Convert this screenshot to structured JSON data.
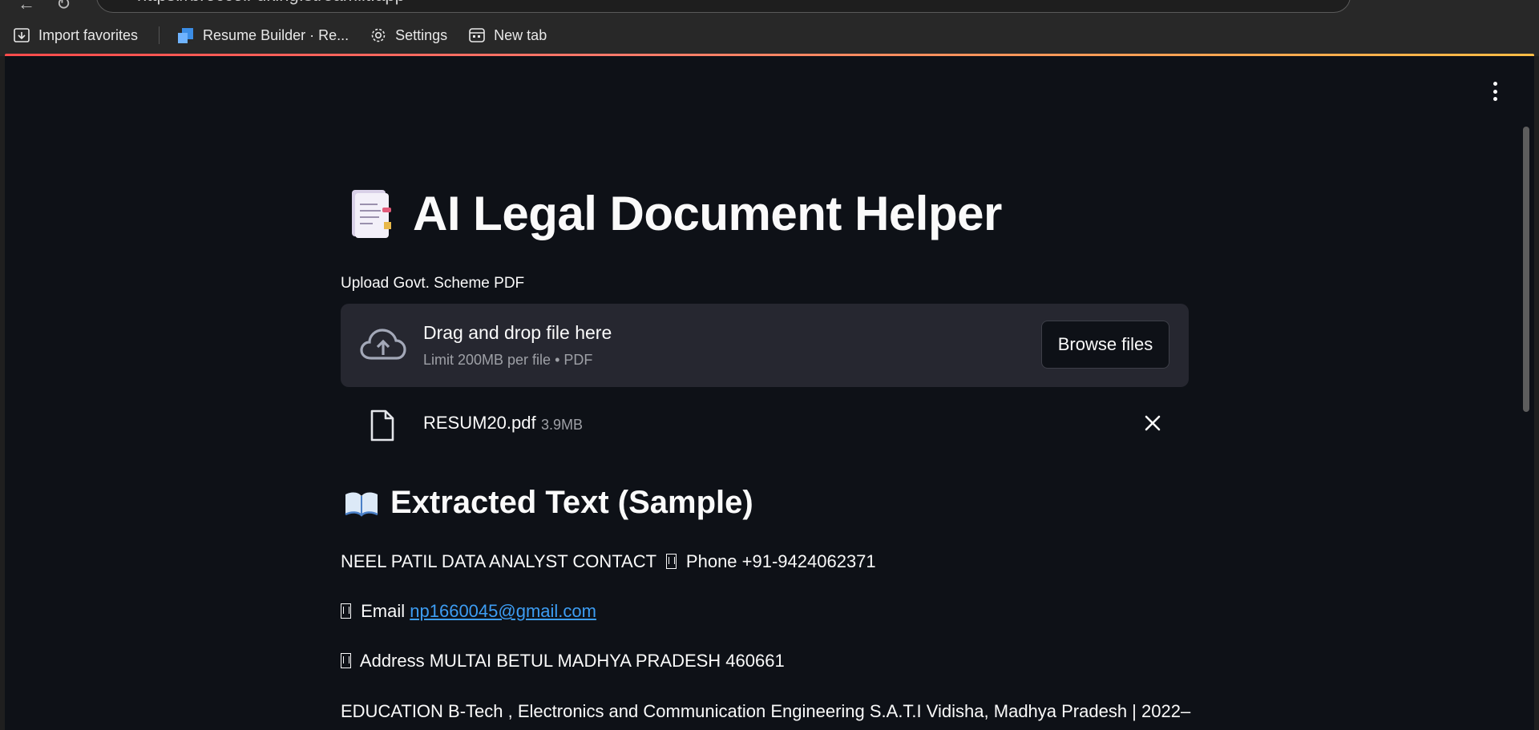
{
  "browser": {
    "url": "https://broccoli-uking.streamlit.app",
    "bookmarks": [
      {
        "label": "Import favorites",
        "icon": "import-icon"
      },
      {
        "label": "Resume Builder · Re...",
        "icon": "resume-builder-favicon"
      },
      {
        "label": "Settings",
        "icon": "gear-icon"
      },
      {
        "label": "New tab",
        "icon": "new-tab-icon"
      }
    ],
    "accent_gradient": [
      "#ff4b4b",
      "#ffbd45"
    ]
  },
  "app": {
    "background": "#0e1117",
    "title": "AI Legal Document Helper",
    "title_icon": "document-icon",
    "uploader": {
      "label": "Upload Govt. Scheme PDF",
      "drag_text": "Drag and drop file here",
      "limit_text": "Limit 200MB per file • PDF",
      "browse_label": "Browse files",
      "icon": "cloud-upload-icon"
    },
    "uploaded_file": {
      "name": "RESUM20.pdf",
      "size": "3.9MB"
    },
    "extracted": {
      "heading": "Extracted Text (Sample)",
      "heading_icon": "open-book-icon",
      "line1": "NEEL PATIL DATA ANALYST CONTACT",
      "line1_tail": "Phone +91-9424062371",
      "email_label": "Email",
      "email": "np1660045@gmail.com",
      "address": "Address MULTAI BETUL MADHYA PRADESH 460661",
      "education": "EDUCATION B-Tech , Electronics and Communication Engineering S.A.T.I Vidisha, Madhya Pradesh | 2022–"
    },
    "link_color": "#3d9df3"
  }
}
